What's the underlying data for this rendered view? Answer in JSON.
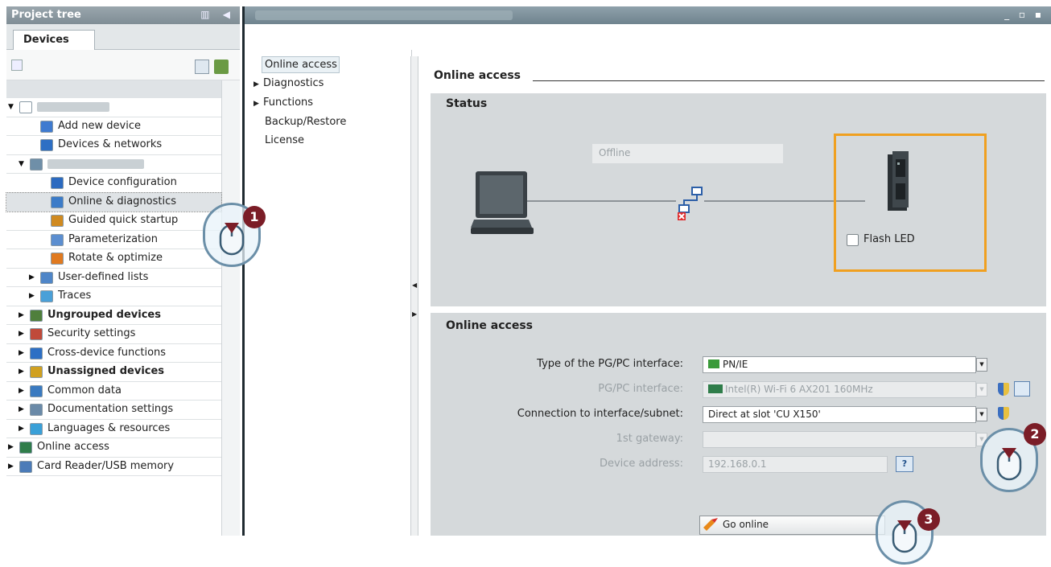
{
  "project_tree": {
    "title": "Project tree",
    "header_icons": "▥ ◀",
    "tab": "Devices",
    "items": [
      {
        "label": "",
        "expanded": true
      },
      {
        "label": "Add new device"
      },
      {
        "label": "Devices & networks"
      },
      {
        "label": "",
        "expanded": true
      },
      {
        "label": "Device configuration"
      },
      {
        "label": "Online & diagnostics",
        "selected": true
      },
      {
        "label": "Guided quick startup"
      },
      {
        "label": "Parameterization"
      },
      {
        "label": "Rotate & optimize"
      },
      {
        "label": "User-defined lists"
      },
      {
        "label": "Traces"
      },
      {
        "label": "Ungrouped devices",
        "bold": true
      },
      {
        "label": "Security settings"
      },
      {
        "label": "Cross-device functions"
      },
      {
        "label": "Unassigned devices",
        "bold": true
      },
      {
        "label": "Common data"
      },
      {
        "label": "Documentation settings"
      },
      {
        "label": "Languages & resources"
      },
      {
        "label": "Online access"
      },
      {
        "label": "Card Reader/USB memory"
      }
    ]
  },
  "window_controls": "_ ▫ ▪",
  "nav": {
    "items": [
      "Online access",
      "Diagnostics",
      "Functions",
      "Backup/Restore",
      "License"
    ],
    "expandable": [
      false,
      true,
      true,
      false,
      false
    ]
  },
  "main": {
    "title": "Online access",
    "status": {
      "title": "Status",
      "connection_state": "Offline",
      "flash_led_label": "Flash LED"
    },
    "online_access": {
      "title": "Online access",
      "fields": [
        {
          "label": "Type of the PG/PC interface:",
          "value": "PN/IE",
          "enabled": true
        },
        {
          "label": "PG/PC interface:",
          "value": "Intel(R) Wi-Fi 6 AX201 160MHz",
          "enabled": false
        },
        {
          "label": "Connection to interface/subnet:",
          "value": "Direct at slot 'CU X150'",
          "enabled": true
        },
        {
          "label": "1st gateway:",
          "value": "",
          "enabled": false
        },
        {
          "label": "Device address:",
          "value": "192.168.0.1",
          "enabled": false
        }
      ],
      "go_online_label": "Go online"
    }
  },
  "callouts": [
    "1",
    "2",
    "3"
  ],
  "colors": {
    "highlight_border": "#f0a020",
    "callout_badge": "#7b1d27",
    "panel_bg": "#d5d9db"
  }
}
